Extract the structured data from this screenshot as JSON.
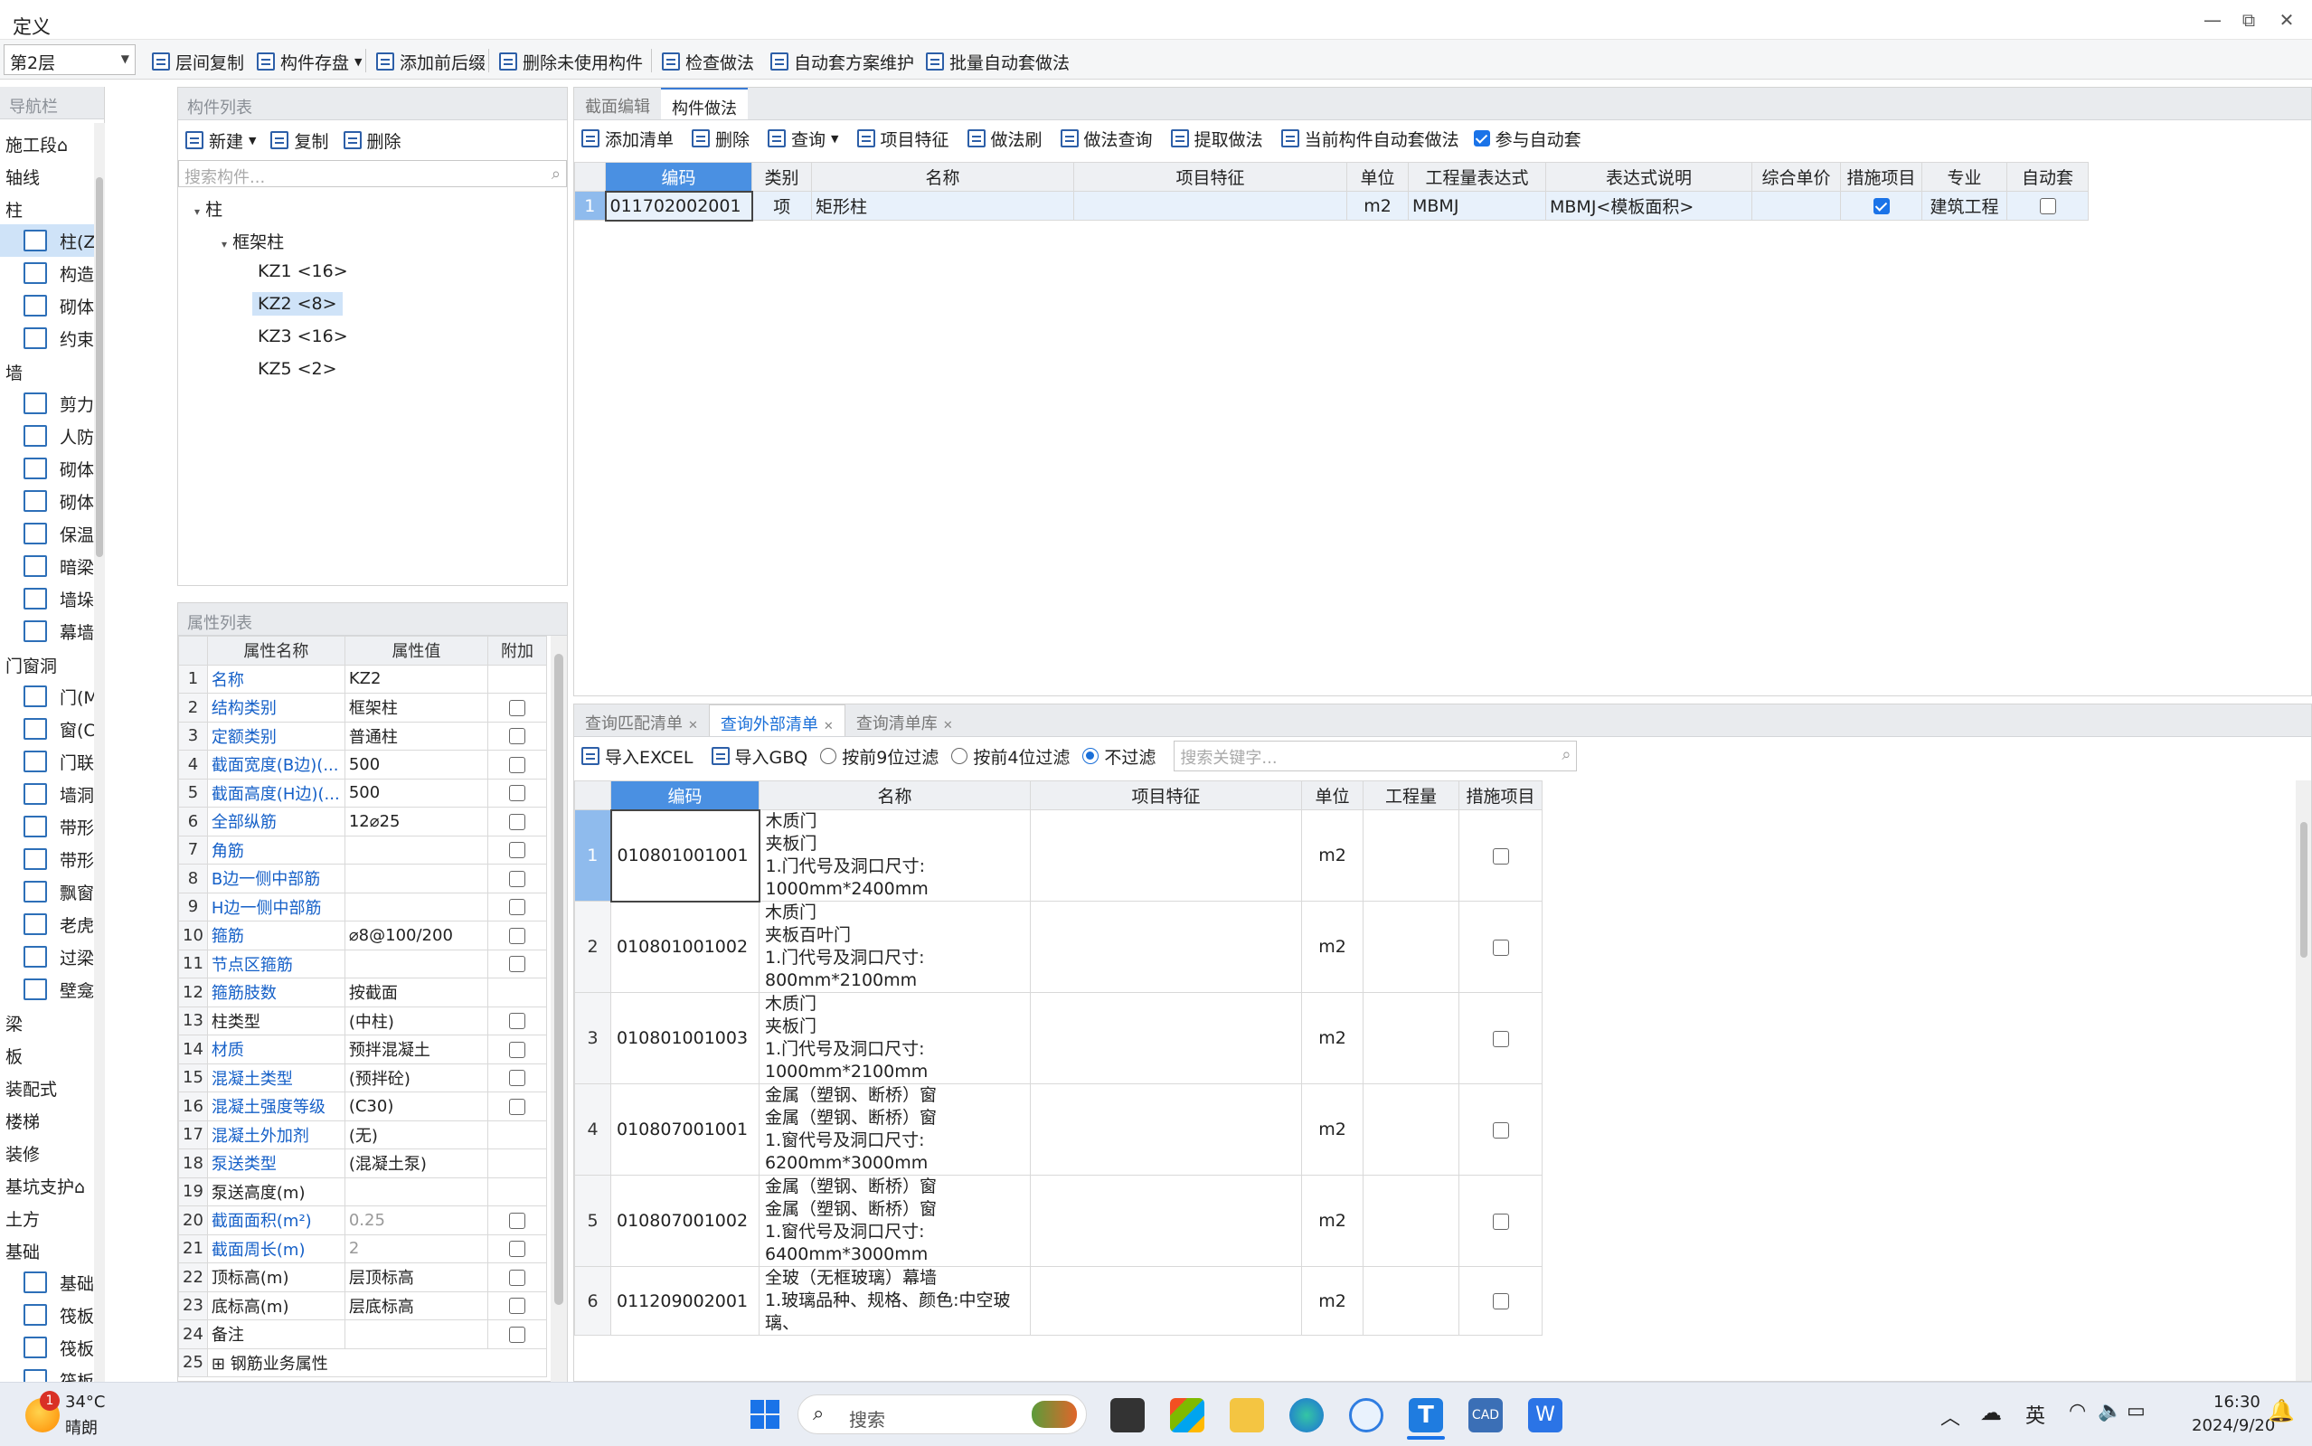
{
  "window": {
    "title": "定义",
    "min": "—",
    "restore": "⧉",
    "close": "✕"
  },
  "toolbar": {
    "floor": "第2层",
    "buttons": [
      "层间复制",
      "构件存盘",
      "添加前后缀",
      "删除未使用构件",
      "检查做法",
      "自动套方案维护",
      "批量自动套做法"
    ]
  },
  "nav": {
    "header": "导航栏",
    "entries": [
      {
        "type": "cat",
        "label": "施工段⌂"
      },
      {
        "type": "cat",
        "label": "轴线"
      },
      {
        "type": "cat",
        "label": "柱"
      },
      {
        "type": "item",
        "label": "柱(Z)",
        "selected": true
      },
      {
        "type": "item",
        "label": "构造柱(Z)"
      },
      {
        "type": "item",
        "label": "砌体柱(Z)"
      },
      {
        "type": "item",
        "label": "约束边缘非."
      },
      {
        "type": "cat",
        "label": "墙"
      },
      {
        "type": "item",
        "label": "剪力墙(Q)"
      },
      {
        "type": "item",
        "label": "人防门框墙."
      },
      {
        "type": "item",
        "label": "砌体墙(Q)"
      },
      {
        "type": "item",
        "label": "砌体加筋(Y)"
      },
      {
        "type": "item",
        "label": "保温墙(Q)"
      },
      {
        "type": "item",
        "label": "暗梁(A)"
      },
      {
        "type": "item",
        "label": "墙垛(E)"
      },
      {
        "type": "item",
        "label": "幕墙(Q)"
      },
      {
        "type": "cat",
        "label": "门窗洞"
      },
      {
        "type": "item",
        "label": "门(M)"
      },
      {
        "type": "item",
        "label": "窗(C)"
      },
      {
        "type": "item",
        "label": "门联窗(A)"
      },
      {
        "type": "item",
        "label": "墙洞(D)"
      },
      {
        "type": "item",
        "label": "带形窗(C)"
      },
      {
        "type": "item",
        "label": "带形洞(D)"
      },
      {
        "type": "item",
        "label": "飘窗(X)"
      },
      {
        "type": "item",
        "label": "老虎窗"
      },
      {
        "type": "item",
        "label": "过梁(G)"
      },
      {
        "type": "item",
        "label": "壁龛(I)"
      },
      {
        "type": "cat",
        "label": "梁"
      },
      {
        "type": "cat",
        "label": "板"
      },
      {
        "type": "cat",
        "label": "装配式"
      },
      {
        "type": "cat",
        "label": "楼梯"
      },
      {
        "type": "cat",
        "label": "装修"
      },
      {
        "type": "cat",
        "label": "基坑支护⌂"
      },
      {
        "type": "cat",
        "label": "土方"
      },
      {
        "type": "cat",
        "label": "基础"
      },
      {
        "type": "item",
        "label": "基础梁(F)"
      },
      {
        "type": "item",
        "label": "筏板基础(M"
      },
      {
        "type": "item",
        "label": "筏板主筋(R)"
      },
      {
        "type": "item",
        "label": "筏板负筋(X"
      }
    ]
  },
  "component_list": {
    "header": "构件列表",
    "new": "新建",
    "copy": "复制",
    "delete": "删除",
    "search_placeholder": "搜索构件...",
    "root": "柱",
    "group": "框架柱",
    "items": [
      "KZ1 <16>",
      "KZ2 <8>",
      "KZ3 <16>",
      "KZ5 <2>"
    ],
    "selected_index": 1
  },
  "properties": {
    "header": "属性列表",
    "cols": [
      "属性名称",
      "属性值",
      "附加"
    ],
    "rows": [
      {
        "n": "1",
        "name": "名称",
        "value": "KZ2",
        "blue": true,
        "cb": false
      },
      {
        "n": "2",
        "name": "结构类别",
        "value": "框架柱",
        "blue": true,
        "cb": true
      },
      {
        "n": "3",
        "name": "定额类别",
        "value": "普通柱",
        "blue": true,
        "cb": true
      },
      {
        "n": "4",
        "name": "截面宽度(B边)(...",
        "value": "500",
        "blue": true,
        "cb": true
      },
      {
        "n": "5",
        "name": "截面高度(H边)(...",
        "value": "500",
        "blue": true,
        "cb": true
      },
      {
        "n": "6",
        "name": "全部纵筋",
        "value": "12⌀25",
        "blue": true,
        "cb": true
      },
      {
        "n": "7",
        "name": "角筋",
        "value": "",
        "blue": true,
        "cb": true
      },
      {
        "n": "8",
        "name": "B边一侧中部筋",
        "value": "",
        "blue": true,
        "cb": true
      },
      {
        "n": "9",
        "name": "H边一侧中部筋",
        "value": "",
        "blue": true,
        "cb": true
      },
      {
        "n": "10",
        "name": "箍筋",
        "value": "⌀8@100/200",
        "blue": true,
        "cb": true
      },
      {
        "n": "11",
        "name": "节点区箍筋",
        "value": "",
        "blue": true,
        "cb": true
      },
      {
        "n": "12",
        "name": "箍筋肢数",
        "value": "按截面",
        "blue": true,
        "cb": false
      },
      {
        "n": "13",
        "name": "柱类型",
        "value": "(中柱)",
        "blue": false,
        "cb": true
      },
      {
        "n": "14",
        "name": "材质",
        "value": "预拌混凝土",
        "blue": true,
        "cb": true
      },
      {
        "n": "15",
        "name": "混凝土类型",
        "value": "(预拌砼)",
        "blue": true,
        "cb": true
      },
      {
        "n": "16",
        "name": "混凝土强度等级",
        "value": "(C30)",
        "blue": true,
        "cb": true
      },
      {
        "n": "17",
        "name": "混凝土外加剂",
        "value": "(无)",
        "blue": true,
        "cb": false
      },
      {
        "n": "18",
        "name": "泵送类型",
        "value": "(混凝土泵)",
        "blue": true,
        "cb": false
      },
      {
        "n": "19",
        "name": "泵送高度(m)",
        "value": "",
        "blue": false,
        "cb": false
      },
      {
        "n": "20",
        "name": "截面面积(m²)",
        "value": "0.25",
        "blue": true,
        "cb": true,
        "grey": true
      },
      {
        "n": "21",
        "name": "截面周长(m)",
        "value": "2",
        "blue": true,
        "cb": true,
        "grey": true
      },
      {
        "n": "22",
        "name": "顶标高(m)",
        "value": "层顶标高",
        "blue": false,
        "cb": true
      },
      {
        "n": "23",
        "name": "底标高(m)",
        "value": "层底标高",
        "blue": false,
        "cb": true
      },
      {
        "n": "24",
        "name": "备注",
        "value": "",
        "blue": false,
        "cb": true
      },
      {
        "n": "25",
        "name": "钢筋业务属性",
        "value": "",
        "blue": false,
        "cb": false,
        "expand": true
      }
    ]
  },
  "method_panel": {
    "tabs": [
      "截面编辑",
      "构件做法"
    ],
    "active_tab": 1,
    "tools": [
      "添加清单",
      "删除",
      "查询",
      "项目特征",
      "做法刷",
      "做法查询",
      "提取做法",
      "当前构件自动套做法",
      "参与自动套"
    ],
    "cols": [
      "编码",
      "类别",
      "名称",
      "项目特征",
      "单位",
      "工程量表达式",
      "表达式说明",
      "综合单价",
      "措施项目",
      "专业",
      "自动套"
    ],
    "row": {
      "n": "1",
      "code": "011702002001",
      "type": "项",
      "name": "矩形柱",
      "feature": "",
      "unit": "m2",
      "expr": "MBMJ",
      "desc": "MBMJ<模板面积>",
      "price": "",
      "measure": true,
      "major": "建筑工程",
      "auto": false
    }
  },
  "query_panel": {
    "tabs": [
      "查询匹配清单",
      "查询外部清单",
      "查询清单库"
    ],
    "active_tab": 1,
    "import_excel": "导入EXCEL",
    "import_gbq": "导入GBQ",
    "filters": [
      "按前9位过滤",
      "按前4位过滤",
      "不过滤"
    ],
    "selected_filter": 2,
    "search_placeholder": "搜索关键字...",
    "cols": [
      "编码",
      "名称",
      "项目特征",
      "单位",
      "工程量",
      "措施项目"
    ],
    "rows": [
      {
        "n": "1",
        "code": "010801001001",
        "name": [
          "木质门",
          "夹板门",
          "1.门代号及洞口尺寸:",
          "1000mm*2400mm"
        ],
        "unit": "m2"
      },
      {
        "n": "2",
        "code": "010801001002",
        "name": [
          "木质门",
          "夹板百叶门",
          "1.门代号及洞口尺寸:",
          "800mm*2100mm"
        ],
        "unit": "m2"
      },
      {
        "n": "3",
        "code": "010801001003",
        "name": [
          "木质门",
          "夹板门",
          "1.门代号及洞口尺寸:",
          "1000mm*2100mm"
        ],
        "unit": "m2"
      },
      {
        "n": "4",
        "code": "010807001001",
        "name": [
          "金属（塑钢、断桥）窗",
          "金属（塑钢、断桥）窗",
          "1.窗代号及洞口尺寸:",
          "6200mm*3000mm"
        ],
        "unit": "m2"
      },
      {
        "n": "5",
        "code": "010807001002",
        "name": [
          "金属（塑钢、断桥）窗",
          "金属（塑钢、断桥）窗",
          "1.窗代号及洞口尺寸:",
          "6400mm*3000mm"
        ],
        "unit": "m2"
      },
      {
        "n": "6",
        "code": "011209002001",
        "name": [
          "全玻（无框玻璃）幕墙",
          "1.玻璃品种、规格、颜色:中空玻璃、"
        ],
        "unit": "m2"
      }
    ]
  },
  "taskbar": {
    "weather_temp": "34°C",
    "weather_desc": "晴朗",
    "badge": "1",
    "search": "搜索",
    "ime": "英",
    "time": "16:30",
    "date": "2024/9/20"
  }
}
